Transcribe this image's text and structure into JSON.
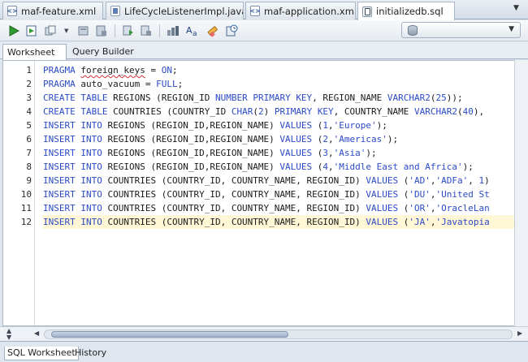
{
  "editor_tabs": [
    {
      "label": "maf-feature.xml",
      "icon": "xml-file-icon"
    },
    {
      "label": "LifeCycleListenerImpl.java",
      "icon": "java-file-icon"
    },
    {
      "label": "maf-application.xml",
      "icon": "xml-file-icon"
    },
    {
      "label": "initializedb.sql",
      "icon": "sql-file-icon",
      "active": true
    }
  ],
  "toolbar": {
    "icons": [
      "run-statement-icon",
      "run-script-icon",
      "commit-icon",
      "rollback-icon",
      "unshared-worksheet-icon",
      "autotrace-icon",
      "explain-plan-icon",
      "sql-tuning-icon",
      "to-upper-lower-icon",
      "clear-icon",
      "history-icon"
    ],
    "connection_icon": "database-icon"
  },
  "worksheet_tabs": [
    "Worksheet",
    "Query Builder"
  ],
  "editor": {
    "line_numbers": [
      "1",
      "2",
      "3",
      "4",
      "5",
      "6",
      "7",
      "8",
      "9",
      "10",
      "11",
      "12"
    ],
    "current_line": 12,
    "lines": [
      "PRAGMA foreign_keys = ON;",
      "PRAGMA auto_vacuum = FULL;",
      "CREATE TABLE REGIONS (REGION_ID NUMBER PRIMARY KEY, REGION_NAME VARCHAR2(25));",
      "CREATE TABLE COUNTRIES (COUNTRY_ID CHAR(2) PRIMARY KEY, COUNTRY_NAME VARCHAR2(40),",
      "INSERT INTO REGIONS (REGION_ID,REGION_NAME) VALUES (1,'Europe');",
      "INSERT INTO REGIONS (REGION_ID,REGION_NAME) VALUES (2,'Americas');",
      "INSERT INTO REGIONS (REGION_ID,REGION_NAME) VALUES (3,'Asia');",
      "INSERT INTO REGIONS (REGION_ID,REGION_NAME) VALUES (4,'Middle East and Africa');",
      "INSERT INTO COUNTRIES (COUNTRY_ID, COUNTRY_NAME, REGION_ID) VALUES ('AD','ADFa', 1)",
      "INSERT INTO COUNTRIES (COUNTRY_ID, COUNTRY_NAME, REGION_ID) VALUES ('DU','United St",
      "INSERT INTO COUNTRIES (COUNTRY_ID, COUNTRY_NAME, REGION_ID) VALUES ('OR','OracleLan",
      "INSERT INTO COUNTRIES (COUNTRY_ID, COUNTRY_NAME, REGION_ID) VALUES ('JA','Javatopia"
    ]
  },
  "bottom_tabs": [
    "SQL Worksheet",
    "History"
  ],
  "colors": {
    "keyword": "#2b4ac7",
    "current_line": "#fff7d6",
    "squiggle": "#d33333"
  }
}
